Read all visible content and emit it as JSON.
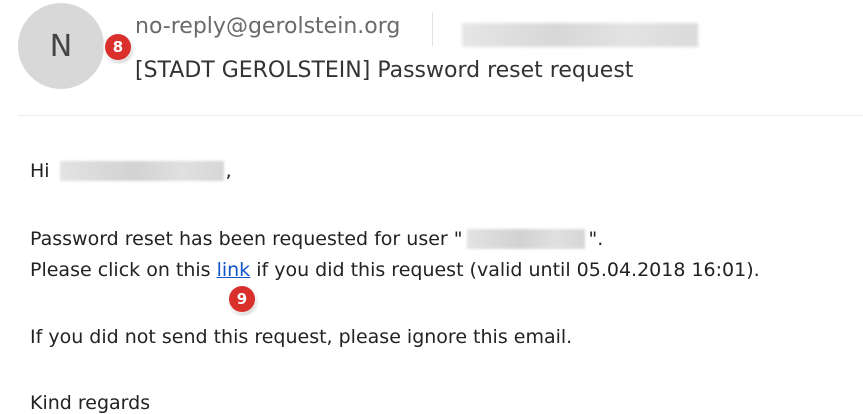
{
  "email": {
    "avatar_initial": "N",
    "sender": "no-reply@gerolstein.org",
    "subject": "[STADT GEROLSTEIN] Password reset request",
    "body": {
      "greeting_prefix": "Hi",
      "greeting_suffix": ",",
      "request_prefix": "Password reset has been requested for user \"",
      "request_suffix": "\".",
      "click_prefix": "Please click on this",
      "link_label": "link",
      "click_suffix": "if you did this request (valid until 05.04.2018 16:01).",
      "ignore_line": "If you did not send this request, please ignore this email.",
      "closing": "Kind regards"
    }
  },
  "annotations": {
    "marker_8": "8",
    "marker_9": "9",
    "marker_color": "#d9302c"
  },
  "colors": {
    "link": "#1155cc",
    "sender_text": "#6a6a6a",
    "avatar_bg": "#d8d8d8"
  }
}
